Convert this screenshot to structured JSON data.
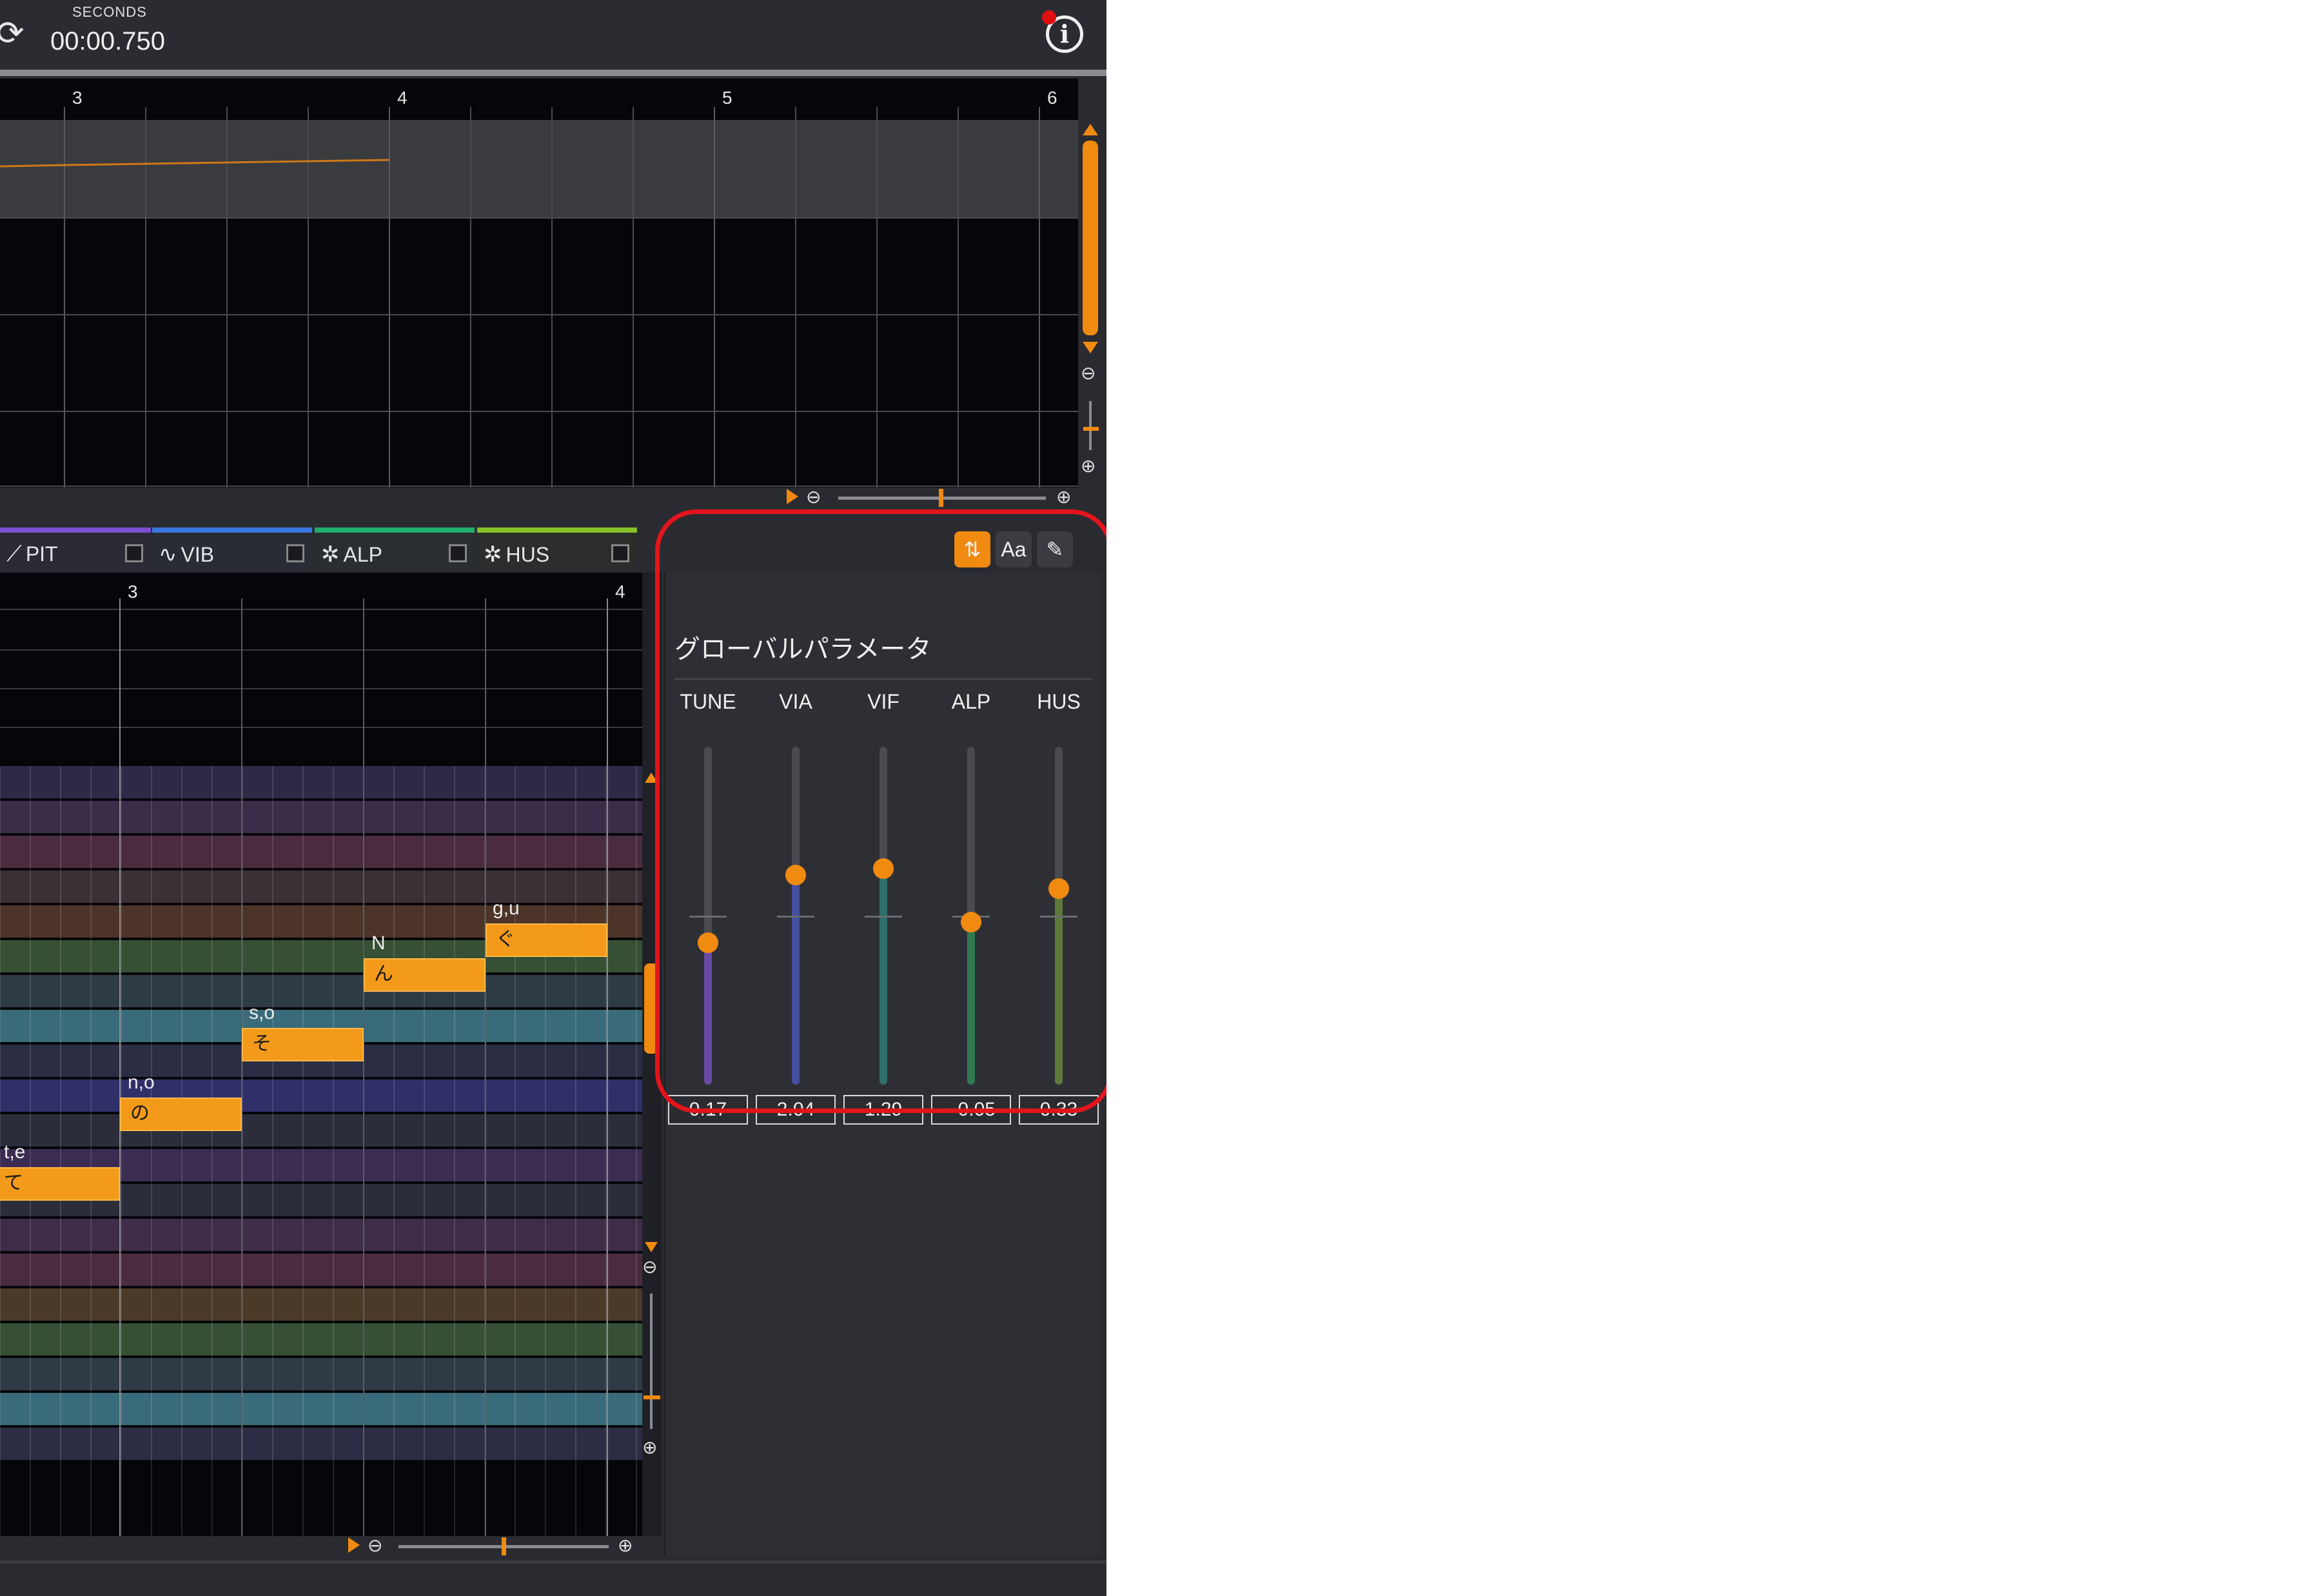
{
  "transport": {
    "time_label": "SECONDS",
    "time_value": "00:00.750"
  },
  "top_ruler": {
    "bars": [
      "3",
      "4",
      "5",
      "6"
    ]
  },
  "track_tabs": [
    {
      "label": "PIT",
      "icon": "pitch-curve-icon",
      "color": "#7b4fd0"
    },
    {
      "label": "VIB",
      "icon": "vibrato-icon",
      "color": "#3a78e0"
    },
    {
      "label": "ALP",
      "icon": "alpha-icon",
      "color": "#1fae6a"
    },
    {
      "label": "HUS",
      "icon": "husky-icon",
      "color": "#86c12a"
    }
  ],
  "roll_ruler": {
    "bars": [
      "3",
      "4"
    ]
  },
  "notes": [
    {
      "lyric": "て",
      "phoneme": "t,e"
    },
    {
      "lyric": "の",
      "phoneme": "n,o"
    },
    {
      "lyric": "そ",
      "phoneme": "s,o"
    },
    {
      "lyric": "ん",
      "phoneme": "N"
    },
    {
      "lyric": "ぐ",
      "phoneme": "g,u"
    }
  ],
  "panel": {
    "title": "グローバルパラメータ",
    "buttons": {
      "font": "Aa"
    },
    "params": [
      {
        "label": "TUNE",
        "value": "0.17",
        "color": "#6a4aa6",
        "level": 0.42
      },
      {
        "label": "VIA",
        "value": "2.04",
        "color": "#4750a0",
        "level": 0.62
      },
      {
        "label": "VIF",
        "value": "1.29",
        "color": "#2f6f6a",
        "level": 0.64
      },
      {
        "label": "ALP",
        "value": "−0.05",
        "color": "#2f7a52",
        "level": 0.48
      },
      {
        "label": "HUS",
        "value": "0.33",
        "color": "#5d7a3a",
        "level": 0.58
      }
    ]
  },
  "colors": {
    "accent": "#f18a10",
    "highlight": "#e4141c"
  }
}
